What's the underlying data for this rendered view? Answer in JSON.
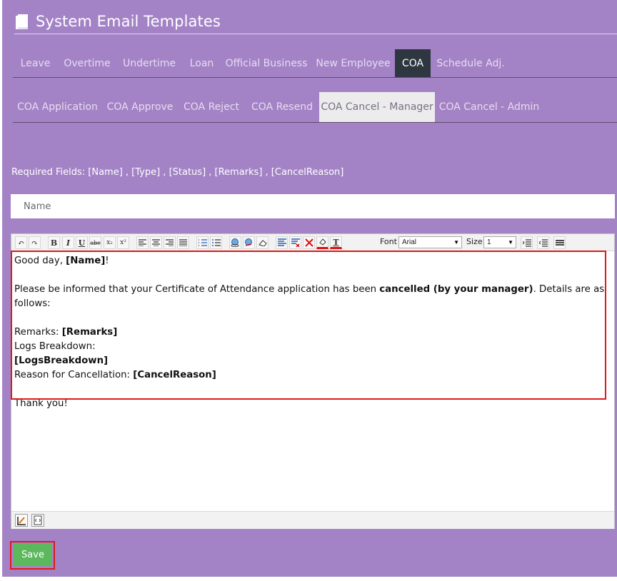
{
  "header": {
    "title": "System Email Templates",
    "icon": "book-icon"
  },
  "main_tabs": [
    {
      "label": "Leave"
    },
    {
      "label": "Overtime"
    },
    {
      "label": "Undertime"
    },
    {
      "label": "Loan"
    },
    {
      "label": "Official Business"
    },
    {
      "label": "New Employee"
    },
    {
      "label": "COA",
      "active": true
    },
    {
      "label": "Schedule Adj."
    }
  ],
  "sub_tabs": [
    {
      "label": "COA Application"
    },
    {
      "label": "COA Approve"
    },
    {
      "label": "COA Reject"
    },
    {
      "label": "COA Resend"
    },
    {
      "label": "COA Cancel - Manager",
      "active": true
    },
    {
      "label": "COA Cancel - Admin"
    }
  ],
  "required_fields": "Required Fields: [Name] , [Type] , [Status] , [Remarks] , [CancelReason]",
  "subject_field": {
    "value": "Name"
  },
  "toolbar": {
    "font_label": "Font",
    "font_value": "Arial",
    "size_label": "Size",
    "size_value": "1"
  },
  "email_body": {
    "line1_prefix": "Good day, ",
    "line1_bold": "[Name]",
    "line1_suffix": "!",
    "line2_prefix": "Please be informed that your Certificate of Attendance application has been ",
    "line2_bold": "cancelled (by your manager)",
    "line2_suffix": ". Details are as follows:",
    "remarks_label": "Remarks: ",
    "remarks_value": "[Remarks]",
    "logs_label": "Logs Breakdown:",
    "logs_value": "[LogsBreakdown]",
    "reason_label": "Reason for Cancellation: ",
    "reason_value": "[CancelReason]",
    "closing": "Thank you!"
  },
  "save_label": "Save",
  "colors": {
    "background": "#a383c6",
    "active_tab": "#2e3640",
    "save_button": "#5cb85c",
    "highlight": "#e01818"
  }
}
